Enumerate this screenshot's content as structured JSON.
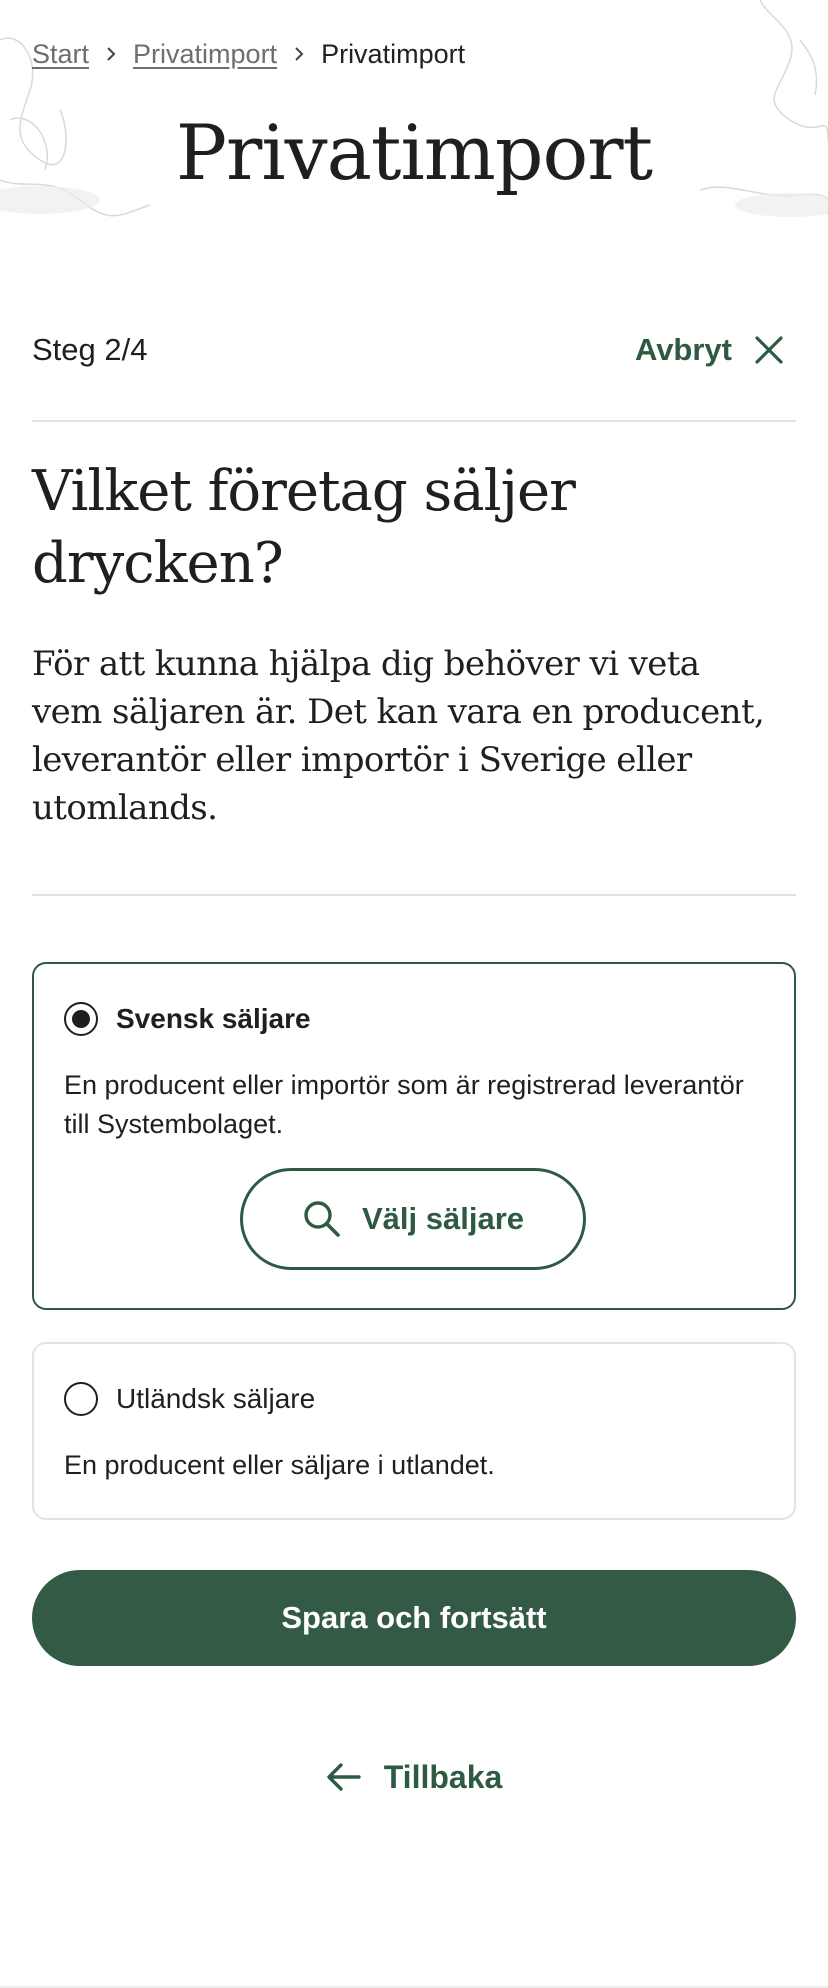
{
  "breadcrumb": {
    "items": [
      {
        "label": "Start",
        "link": true
      },
      {
        "label": "Privatimport",
        "link": true
      },
      {
        "label": "Privatimport",
        "link": false
      }
    ],
    "separator_icon": "chevron-right-icon"
  },
  "header": {
    "title": "Privatimport",
    "background_icon": "map-illustration"
  },
  "wizard": {
    "step_label": "Steg 2/4",
    "cancel_label": "Avbryt",
    "cancel_icon": "close-icon"
  },
  "question": {
    "title": "Vilket företag säljer drycken?",
    "description": "För att kunna hjälpa dig behöver vi veta vem säljaren är. Det kan vara en producent, leverantör eller importör i Sverige eller utomlands."
  },
  "options": [
    {
      "label": "Svensk säljare",
      "description": "En producent eller importör som är registrerad leverantör till Systembolaget.",
      "selected": true,
      "action": {
        "label": "Välj säljare",
        "icon": "search-icon"
      }
    },
    {
      "label": "Utländsk säljare",
      "description": "En producent eller säljare i utlandet.",
      "selected": false
    }
  ],
  "actions": {
    "submit_label": "Spara och fortsätt",
    "back_label": "Tillbaka",
    "back_icon": "arrow-left-icon"
  },
  "colors": {
    "accent": "#2f5a42",
    "primary_button": "#335a45",
    "divider": "#e3e3e3",
    "text": "#1f1f1f",
    "breadcrumb_link": "#6e6e6e"
  }
}
